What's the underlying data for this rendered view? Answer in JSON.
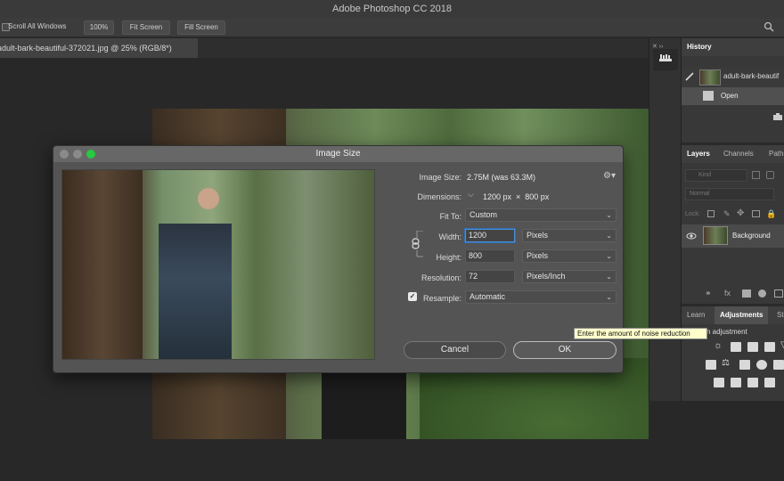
{
  "window": {
    "title": "Adobe Photoshop CC 2018"
  },
  "options_bar": {
    "scroll_all_windows": "Scroll All Windows",
    "zoom_100": "100%",
    "fit_screen": "Fit Screen",
    "fill_screen": "Fill Screen"
  },
  "document": {
    "tab_label": "adult-bark-beautiful-372021.jpg @ 25% (RGB/8*)"
  },
  "history": {
    "title": "History",
    "snapshot_label": "adult-bark-beautif",
    "items": [
      "Open"
    ]
  },
  "layers_panel": {
    "tabs": [
      "Layers",
      "Channels",
      "Paths"
    ],
    "kind_placeholder": "Kind",
    "blend_mode": "Normal",
    "lock_label": "Lock:",
    "layers": [
      {
        "name": "Background"
      }
    ]
  },
  "adjustments_panel": {
    "tabs": [
      "Learn",
      "Adjustments",
      "St"
    ],
    "subtitle": "n adjustment"
  },
  "dialog": {
    "title": "Image Size",
    "image_size_label": "Image Size:",
    "image_size_value": "2.75M (was 63.3M)",
    "dimensions_label": "Dimensions:",
    "dimensions_value": "1200 px  ×  800 px",
    "fit_to_label": "Fit To:",
    "fit_to_value": "Custom",
    "width_label": "Width:",
    "width_value": "1200",
    "width_unit": "Pixels",
    "height_label": "Height:",
    "height_value": "800",
    "height_unit": "Pixels",
    "resolution_label": "Resolution:",
    "resolution_value": "72",
    "resolution_unit": "Pixels/Inch",
    "resample_label": "Resample:",
    "resample_value": "Automatic",
    "resample_checked": true,
    "cancel_label": "Cancel",
    "ok_label": "OK",
    "tooltip": "Enter the amount of noise reduction"
  },
  "colors": {
    "accent_blue": "#4a90d9",
    "traffic_green": "#28c840",
    "tooltip_bg": "#ffffcc"
  }
}
